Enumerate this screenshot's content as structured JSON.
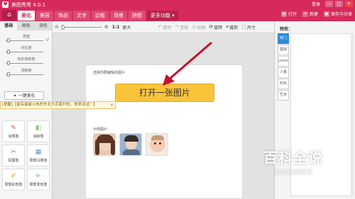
{
  "window": {
    "title": "美图秀秀 4.0.1",
    "login": "登录",
    "controls": [
      "—",
      "□",
      "✕"
    ]
  },
  "nav": {
    "tabs": [
      "美化",
      "美容",
      "饰品",
      "文字",
      "边框",
      "场景",
      "拼图",
      "更多功能 ▾"
    ],
    "active": "美化",
    "right": [
      "打开",
      "新建",
      "保存与分享"
    ]
  },
  "left": {
    "subtabs": [
      "基础",
      "高级",
      "调色"
    ],
    "sliders": [
      "亮度",
      "对比度",
      "色彩饱和度",
      "清晰度"
    ],
    "onekey": "一键美化",
    "tools": [
      {
        "label": "涂鸦笔",
        "icon": "brush-icon",
        "color": "#e44"
      },
      {
        "label": "消除笔",
        "icon": "eraser-icon",
        "color": "#8c6"
      },
      {
        "label": "抠图笔",
        "icon": "cutout-icon",
        "color": "#39c"
      },
      {
        "label": "局部马赛克",
        "icon": "mosaic-icon",
        "color": "#69c"
      },
      {
        "label": "局部彩色笔",
        "icon": "color-brush-icon",
        "color": "#c93"
      },
      {
        "label": "局部变色笔",
        "icon": "recolor-brush-icon",
        "color": "#6b6"
      }
    ]
  },
  "toolbar": {
    "zoom_value": 0.0,
    "actual_size": "1:1",
    "fit": "原大",
    "items": [
      {
        "label": "撤销",
        "disabled": true
      },
      {
        "label": "重做",
        "disabled": true
      },
      {
        "label": "原图",
        "disabled": true
      },
      {
        "label": "旋转",
        "disabled": false
      },
      {
        "label": "裁剪",
        "disabled": false
      },
      {
        "label": "尺寸",
        "disabled": false
      }
    ]
  },
  "canvas": {
    "prompt": "选择你要编辑的图片",
    "open_button": "打开一张图片",
    "samples_label": "示例图片："
  },
  "notification": {
    "text": "[提醒]【星有最最火热的东北大花套衬啦，快来试试！】",
    "close": "✕"
  },
  "right": {
    "title": "特效：",
    "categories": [
      "热门",
      "基础",
      "Lomo",
      "人像",
      "时尚",
      "艺术"
    ],
    "active": "热门"
  },
  "watermark": {
    "main": "百科全说",
    "sub": "助你轻松解决"
  },
  "colors": {
    "brand": "#d62a5b",
    "open_button": "#f9c43b",
    "arrow": "#c8102e",
    "active_category": "#2d8ad8"
  }
}
